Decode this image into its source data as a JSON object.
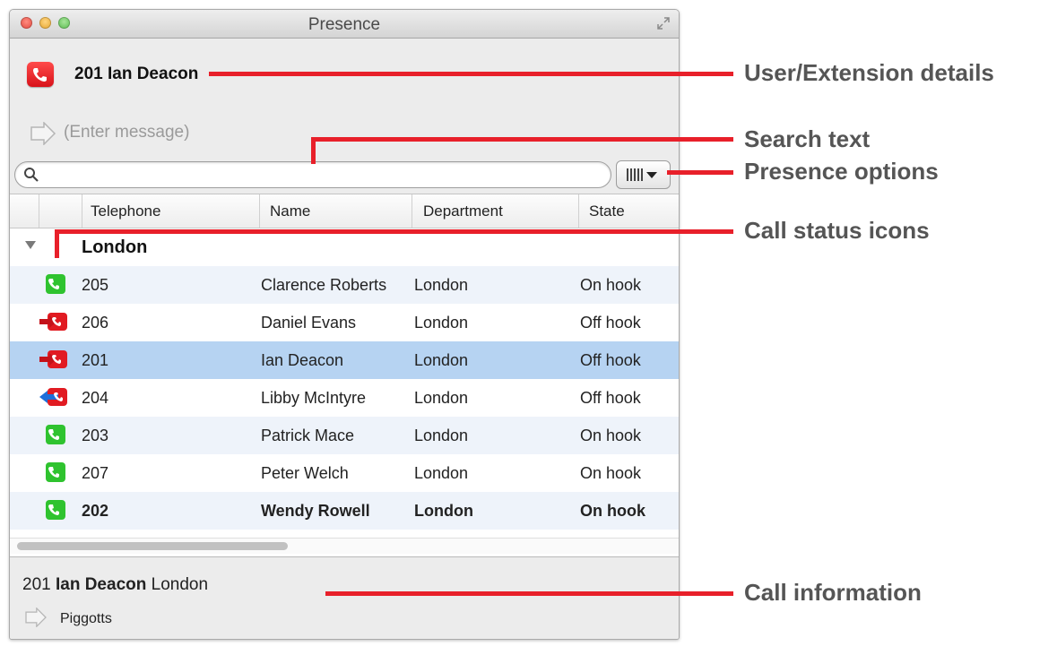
{
  "window": {
    "title": "Presence"
  },
  "user": {
    "extension_name": "201 Ian Deacon",
    "message_placeholder": "(Enter message)"
  },
  "search": {
    "placeholder": ""
  },
  "table": {
    "columns": [
      "Telephone",
      "Name",
      "Department",
      "State"
    ],
    "group": "London",
    "rows": [
      {
        "telephone": "205",
        "name": "Clarence Roberts",
        "department": "London",
        "state": "On hook",
        "status_icon": "green-phone-icon"
      },
      {
        "telephone": "206",
        "name": "Daniel Evans",
        "department": "London",
        "state": "Off hook",
        "status_icon": "red-outgoing-call-icon"
      },
      {
        "telephone": "201",
        "name": "Ian Deacon",
        "department": "London",
        "state": "Off hook",
        "status_icon": "red-outgoing-call-icon"
      },
      {
        "telephone": "204",
        "name": "Libby McIntyre",
        "department": "London",
        "state": "Off hook",
        "status_icon": "blue-incoming-call-icon"
      },
      {
        "telephone": "203",
        "name": "Patrick Mace",
        "department": "London",
        "state": "On hook",
        "status_icon": "green-phone-icon"
      },
      {
        "telephone": "207",
        "name": "Peter Welch",
        "department": "London",
        "state": "On hook",
        "status_icon": "green-phone-icon"
      },
      {
        "telephone": "202",
        "name": "Wendy Rowell",
        "department": "London",
        "state": "On hook",
        "status_icon": "green-phone-icon"
      }
    ]
  },
  "call_info": {
    "extension": "201",
    "name": "Ian Deacon",
    "location": "London",
    "message": "Piggotts"
  },
  "annotations": {
    "user_details": "User/Extension details",
    "search_text": "Search text",
    "presence_options": "Presence options",
    "call_status_icons": "Call status icons",
    "call_information": "Call information"
  },
  "colors": {
    "annotation_line": "#e8202a",
    "annotation_text": "#555555",
    "selected_row": "#b6d3f2"
  }
}
